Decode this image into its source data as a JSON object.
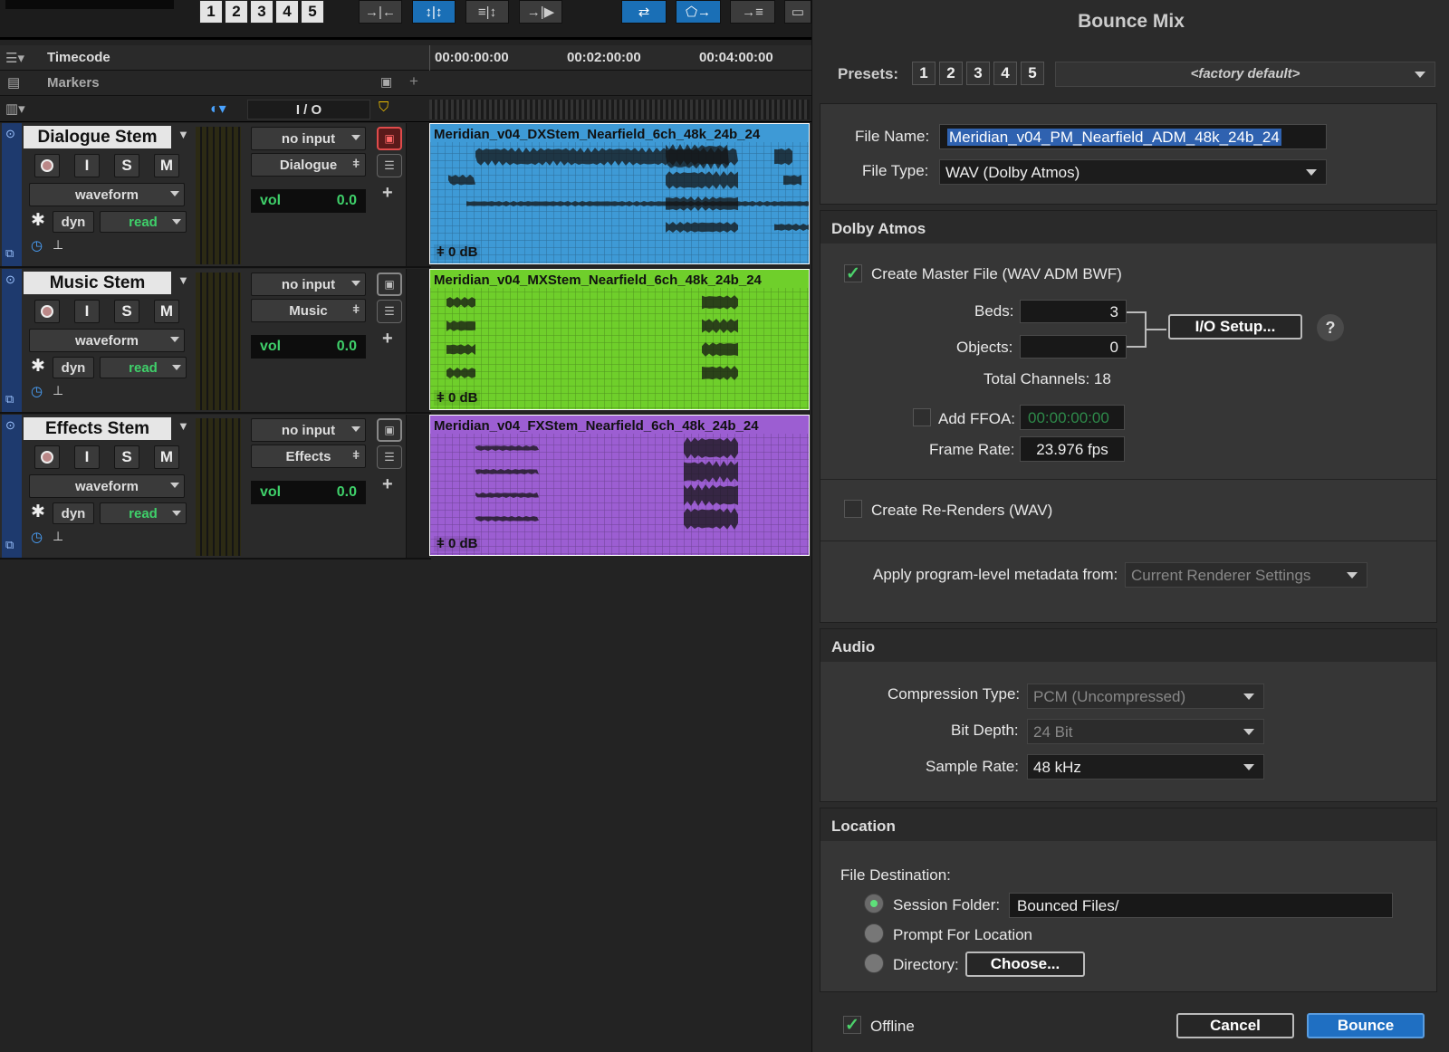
{
  "toolbar": {
    "grid_nums": [
      "1",
      "2",
      "3",
      "4",
      "5"
    ]
  },
  "ruler": {
    "timecode_label": "Timecode",
    "markers_label": "Markers",
    "io_label": "I / O",
    "times": [
      "00:00:00:00",
      "00:02:00:00",
      "00:04:00:00"
    ]
  },
  "tracks": [
    {
      "name": "Dialogue Stem",
      "input": "no input",
      "output": "Dialogue",
      "view": "waveform",
      "dyn": "dyn",
      "automation": "read",
      "vol_label": "vol",
      "vol_value": "0.0",
      "rec": "",
      "input_mon": "I",
      "solo": "S",
      "mute": "M",
      "clip_name": "Meridian_v04_DXStem_Nearfield_6ch_48k_24b_24",
      "clip_gain": "0 dB",
      "color": "#3e9ad6"
    },
    {
      "name": "Music Stem",
      "input": "no input",
      "output": "Music",
      "view": "waveform",
      "dyn": "dyn",
      "automation": "read",
      "vol_label": "vol",
      "vol_value": "0.0",
      "rec": "",
      "input_mon": "I",
      "solo": "S",
      "mute": "M",
      "clip_name": "Meridian_v04_MXStem_Nearfield_6ch_48k_24b_24",
      "clip_gain": "0 dB",
      "color": "#6fcf2b"
    },
    {
      "name": "Effects Stem",
      "input": "no input",
      "output": "Effects",
      "view": "waveform",
      "dyn": "dyn",
      "automation": "read",
      "vol_label": "vol",
      "vol_value": "0.0",
      "rec": "",
      "input_mon": "I",
      "solo": "S",
      "mute": "M",
      "clip_name": "Meridian_v04_FXStem_Nearfield_6ch_48k_24b_24",
      "clip_gain": "0 dB",
      "color": "#9c5ed2"
    }
  ],
  "dialog": {
    "title": "Bounce Mix",
    "presets_label": "Presets:",
    "preset_nums": [
      "1",
      "2",
      "3",
      "4",
      "5"
    ],
    "preset_value": "<factory default>",
    "file_name_label": "File Name:",
    "file_name_value": "Meridian_v04_PM_Nearfield_ADM_48k_24b_24",
    "file_type_label": "File Type:",
    "file_type_value": "WAV (Dolby Atmos)",
    "atmos": {
      "header": "Dolby Atmos",
      "create_master_label": "Create Master File (WAV ADM BWF)",
      "create_master_checked": "✓",
      "beds_label": "Beds:",
      "beds_value": "3",
      "objects_label": "Objects:",
      "objects_value": "0",
      "io_setup": "I/O Setup...",
      "help": "?",
      "total_channels": "Total Channels: 18",
      "add_ffoa_label": "Add FFOA:",
      "ffoa_value": "00:00:00:00",
      "frame_rate_label": "Frame Rate:",
      "frame_rate_value": "23.976 fps",
      "rerenders_label": "Create Re-Renders (WAV)",
      "metadata_label": "Apply program-level metadata from:",
      "metadata_value": "Current Renderer Settings"
    },
    "audio": {
      "header": "Audio",
      "compression_label": "Compression Type:",
      "compression_value": "PCM (Uncompressed)",
      "bit_depth_label": "Bit Depth:",
      "bit_depth_value": "24 Bit",
      "sample_rate_label": "Sample Rate:",
      "sample_rate_value": "48 kHz"
    },
    "location": {
      "header": "Location",
      "destination_label": "File Destination:",
      "session_folder_label": "Session Folder:",
      "session_folder_value": "Bounced Files/",
      "prompt_label": "Prompt For Location",
      "directory_label": "Directory:",
      "choose": "Choose..."
    },
    "offline_label": "Offline",
    "offline_checked": "✓",
    "cancel": "Cancel",
    "bounce": "Bounce"
  }
}
